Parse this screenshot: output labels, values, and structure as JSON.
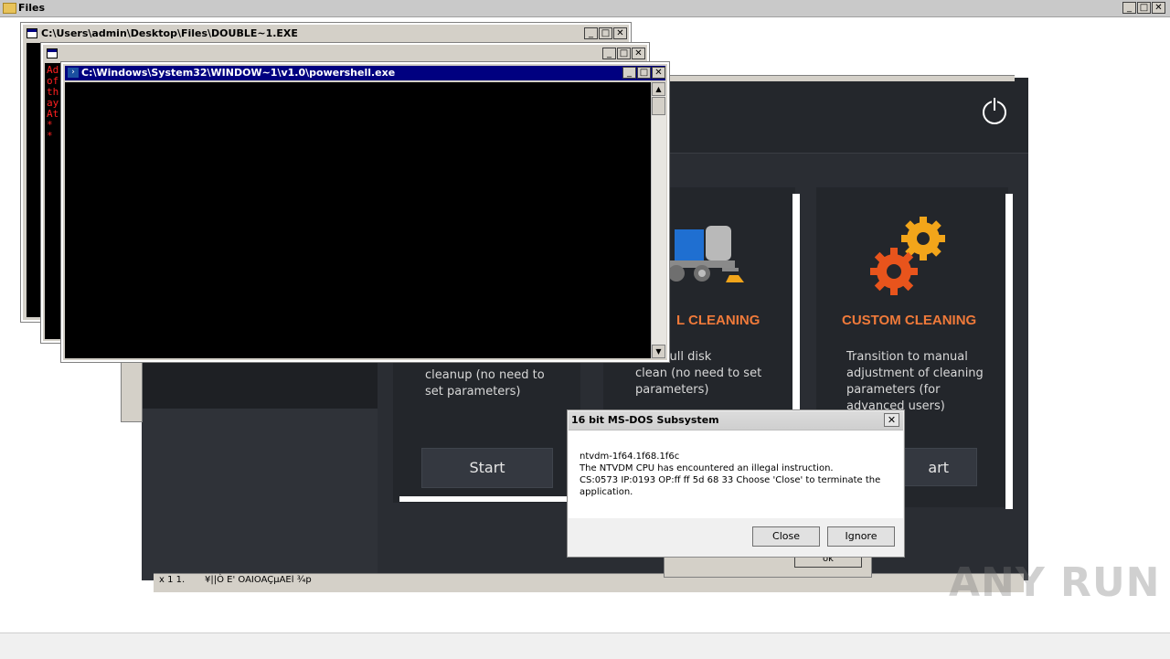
{
  "explorer": {
    "title": "Files"
  },
  "window_controls": {
    "min": "_",
    "max": "□",
    "close": "✕"
  },
  "dos_window": {
    "title": "C:\\Users\\admin\\Desktop\\Files\\DOUBLE~1.EXE"
  },
  "cmd_window": {
    "title": "",
    "red_lines": [
      "Ad",
      "of",
      "th",
      "ay",
      "At",
      "*",
      "*"
    ]
  },
  "ps_window": {
    "title": "C:\\Windows\\System32\\WINDOW~1\\v1.0\\powershell.exe"
  },
  "app": {
    "cards": [
      {
        "title": "",
        "desc": "cleanup (no need to\nset parameters)",
        "button": "Start"
      },
      {
        "title": "L CLEANING",
        "desc": "s for full disk\nclean (no need to set\nparameters)",
        "button": ""
      },
      {
        "title": "CUSTOM CLEANING",
        "desc": "Transition to manual\nadjustment of cleaning\nparameters (for\nadvanced users)",
        "button": "art"
      }
    ],
    "hidden_button": "ok",
    "bottom_text_1": "x  1 1.",
    "bottom_text_2": "¥||Ò E' OAIOAÇµAEl ¾p"
  },
  "dialog": {
    "title": "16 bit MS-DOS Subsystem",
    "line1": "ntvdm-1f64.1f68.1f6c",
    "line2": "The NTVDM CPU has encountered an illegal instruction.",
    "line3": "CS:0573 IP:0193 OP:ff ff 5d 68 33 Choose 'Close' to terminate the application.",
    "close_button": "Close",
    "ignore_button": "Ignore"
  },
  "watermark": "ANY RUN",
  "colors": {
    "accent": "#f07a3a",
    "app_bg": "#2a2d33",
    "titlebar_blue": "#000080"
  }
}
